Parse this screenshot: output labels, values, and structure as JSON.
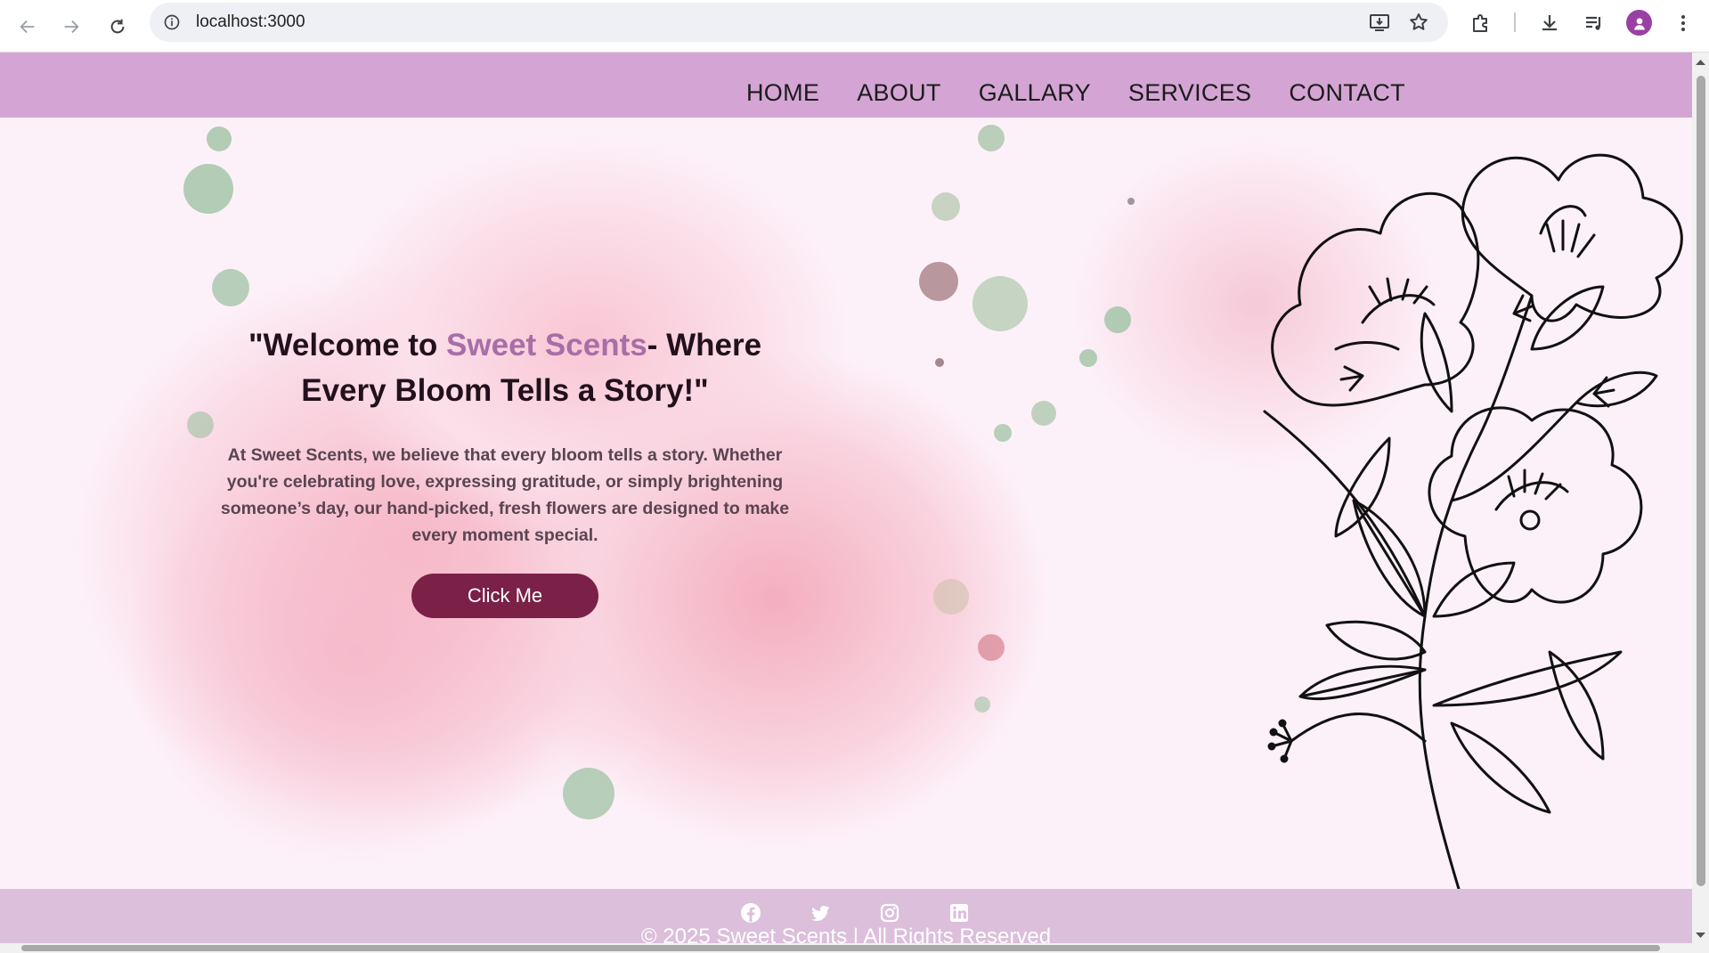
{
  "browser": {
    "url": "localhost:3000",
    "icons": [
      "back-arrow-icon",
      "forward-arrow-icon",
      "reload-icon",
      "info-icon",
      "install-icon",
      "star-icon",
      "extensions-icon",
      "download-icon",
      "media-queue-icon",
      "profile-icon",
      "kebab-menu-icon"
    ]
  },
  "nav": {
    "items": [
      {
        "label": "HOME"
      },
      {
        "label": "ABOUT"
      },
      {
        "label": "GALLARY"
      },
      {
        "label": "SERVICES"
      },
      {
        "label": "CONTACT"
      }
    ]
  },
  "hero": {
    "headline_prefix": "\"Welcome to ",
    "headline_brand": "Sweet Scents",
    "headline_suffix": "- Where Every Bloom Tells a Story!\"",
    "paragraph": "At Sweet Scents, we believe that every bloom tells a story. Whether you're celebrating love, expressing gratitude, or simply brightening someone’s day, our hand-picked, fresh flowers are designed to make every moment special.",
    "button_label": "Click Me"
  },
  "footer": {
    "social_icons": [
      "facebook-icon",
      "twitter-icon",
      "instagram-icon",
      "linkedin-icon"
    ],
    "copyright": "© 2025 Sweet Scents | All Rights Reserved"
  },
  "colors": {
    "navbar": "#d4a5d4",
    "footer": "#dbbfdb",
    "brand_accent": "#a86ea7",
    "button": "#7b2047",
    "page_bg": "#fdf1f9"
  }
}
